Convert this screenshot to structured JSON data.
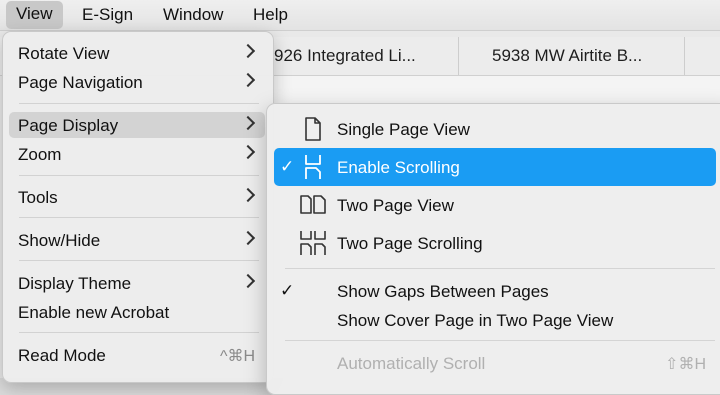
{
  "menubar": {
    "items": [
      "View",
      "E-Sign",
      "Window",
      "Help"
    ]
  },
  "tabs": [
    "926 Integrated Li...",
    "5938 MW Airtite B..."
  ],
  "view_menu": {
    "items": [
      {
        "label": "Rotate View",
        "submenu": true
      },
      {
        "label": "Page Navigation",
        "submenu": true
      },
      {
        "label": "Page Display",
        "submenu": true,
        "highlighted": true
      },
      {
        "label": "Zoom",
        "submenu": true
      },
      {
        "label": "Tools",
        "submenu": true
      },
      {
        "label": "Show/Hide",
        "submenu": true
      },
      {
        "label": "Display Theme",
        "submenu": true
      },
      {
        "label": "Enable new Acrobat"
      },
      {
        "label": "Read Mode",
        "shortcut": "^⌘H"
      }
    ]
  },
  "page_display_submenu": {
    "items": [
      {
        "label": "Single Page View",
        "icon": "single-page-icon"
      },
      {
        "label": "Enable Scrolling",
        "icon": "scrolling-icon",
        "checked": "✓",
        "selected": true
      },
      {
        "label": "Two Page View",
        "icon": "two-page-icon"
      },
      {
        "label": "Two Page Scrolling",
        "icon": "two-page-scrolling-icon"
      },
      {
        "label": "Show Gaps Between Pages",
        "checked": "✓"
      },
      {
        "label": "Show Cover Page in Two Page View"
      },
      {
        "label": "Automatically Scroll",
        "shortcut": "⇧⌘H",
        "disabled": true
      }
    ]
  },
  "colors": {
    "selection": "#1a9cf3",
    "menu_highlight": "#d3d3d3"
  }
}
